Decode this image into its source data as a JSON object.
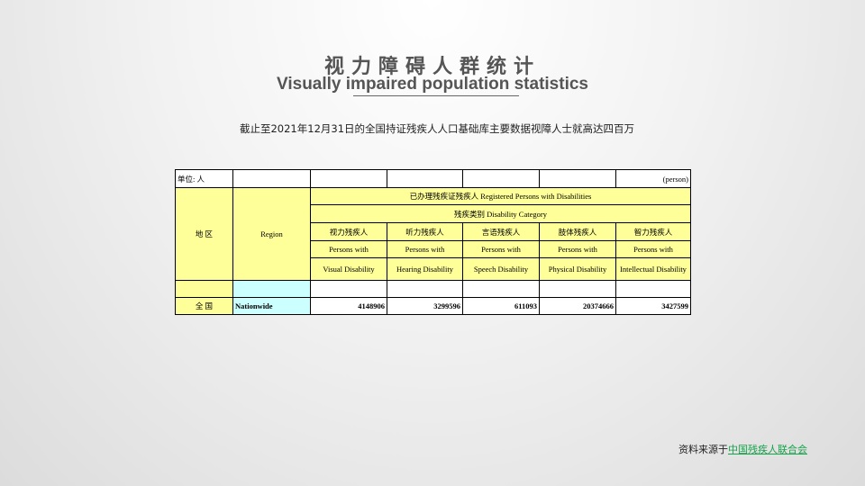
{
  "slide": {
    "title_cn": "视力障碍人群统计",
    "title_en": "Visually impaired population statistics",
    "subtitle": "截止至2021年12月31日的全国持证残疾人人口基础库主要数据视障人士就高达四百万",
    "source_prefix": "资料来源于",
    "source_link": "中国残疾人联合会"
  },
  "table": {
    "unit_label": "单位: 人",
    "unit_en": "(person)",
    "col_region_cn": "地 区",
    "col_region_en": "Region",
    "header_registered": "已办理残疾证残疾人  Registered Persons with Disabilities",
    "header_category": "残疾类别  Disability Category",
    "categories": [
      {
        "cn": "视力残疾人",
        "en1": "Persons with",
        "en2": "Visual Disability"
      },
      {
        "cn": "听力残疾人",
        "en1": "Persons with",
        "en2": "Hearing Disability"
      },
      {
        "cn": "言语残疾人",
        "en1": "Persons with",
        "en2": "Speech Disability"
      },
      {
        "cn": "肢体残疾人",
        "en1": "Persons with",
        "en2": "Physical Disability"
      },
      {
        "cn": "智力残疾人",
        "en1": "Persons with",
        "en2": "Intellectual Disability"
      }
    ],
    "row": {
      "cn": "全 国",
      "en": "Nationwide",
      "values": [
        "4148906",
        "3299596",
        "611093",
        "20374666",
        "3427599"
      ]
    }
  }
}
